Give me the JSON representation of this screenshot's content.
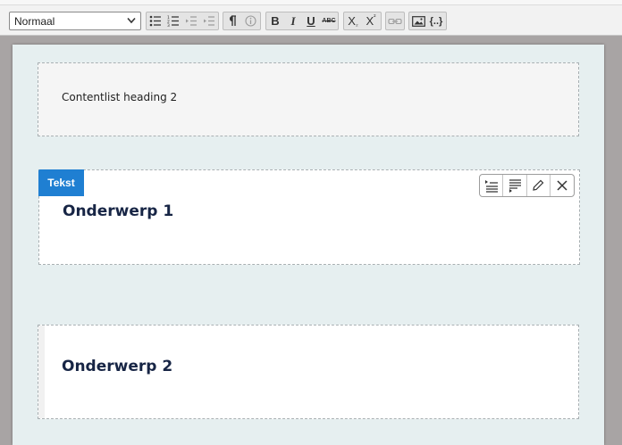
{
  "toolbar": {
    "format_select": {
      "value": "Normaal",
      "icon": "chevron-down-icon"
    },
    "list_group": [
      "bulleted-list-icon",
      "numbered-list-icon",
      "decrease-indent-icon",
      "increase-indent-icon"
    ],
    "block_group": [
      "pilcrow-icon",
      "info-icon"
    ],
    "style_group": {
      "bold": "B",
      "italic": "I",
      "underline": "U",
      "strike": "ABC"
    },
    "script_group": {
      "subscript": "X",
      "subscript_mark": "₂",
      "superscript": "X",
      "superscript_mark": "²"
    },
    "link_group": [
      "link-icon"
    ],
    "insert_group": [
      "image-icon",
      "placeholder-icon"
    ],
    "placeholder_label": "{..}"
  },
  "content": {
    "block1_text": "Contentlist heading 2",
    "block2_badge": "Tekst",
    "block2_heading": "Onderwerp 1",
    "block3_heading": "Onderwerp 2"
  },
  "inline_toolbar": [
    "align-left-icon",
    "align-right-icon",
    "pencil-icon",
    "close-icon"
  ],
  "colors": {
    "accent": "#1f7fd2",
    "heading": "#172545",
    "canvas": "#e6eff0"
  }
}
